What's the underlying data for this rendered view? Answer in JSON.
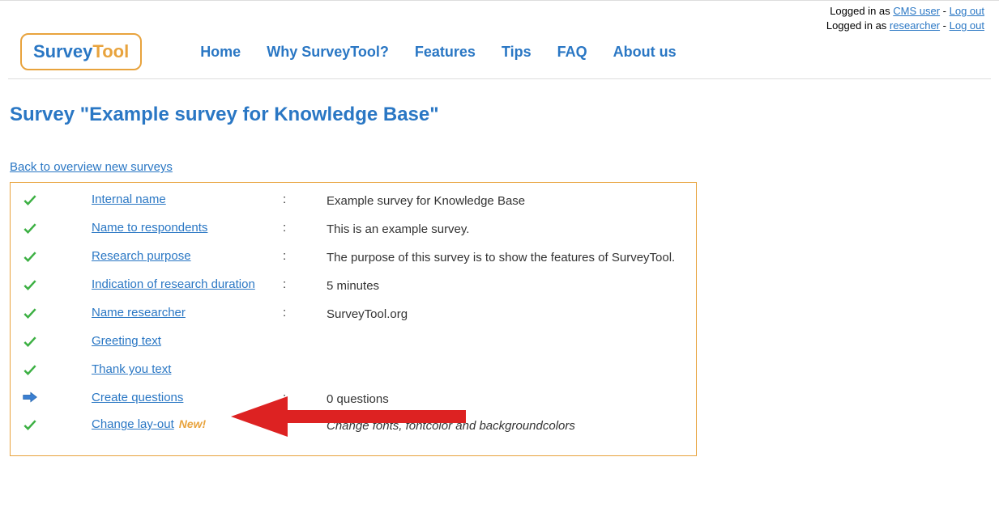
{
  "login": {
    "line1_prefix": "Logged in as ",
    "line1_user": "CMS user",
    "line1_sep": " - ",
    "line1_logout": "Log out",
    "line2_prefix": "Logged in as ",
    "line2_user": "researcher",
    "line2_sep": " - ",
    "line2_logout": "Log out"
  },
  "logo": {
    "part1": "Survey",
    "part2": "Tool"
  },
  "nav": {
    "home": "Home",
    "why": "Why SurveyTool?",
    "features": "Features",
    "tips": "Tips",
    "faq": "FAQ",
    "about": "About us"
  },
  "page_title": "Survey \"Example survey for Knowledge Base\"",
  "back_link": "Back to overview new surveys",
  "rows": {
    "internal_name": {
      "label": "Internal name",
      "value": "Example survey for Knowledge Base"
    },
    "name_respondents": {
      "label": "Name to respondents",
      "value": "This is an example survey."
    },
    "research_purpose": {
      "label": "Research purpose",
      "value": "The purpose of this survey is to show the features of SurveyTool."
    },
    "duration": {
      "label": "Indication of research duration",
      "value": "5 minutes"
    },
    "name_researcher": {
      "label": "Name researcher",
      "value": "SurveyTool.org"
    },
    "greeting": {
      "label": "Greeting text"
    },
    "thankyou": {
      "label": "Thank you text"
    },
    "create_questions": {
      "label": "Create questions",
      "value": "0 questions"
    },
    "layout": {
      "label": "Change lay-out",
      "new": "New!",
      "value": "Change fonts, fontcolor and backgroundcolors"
    }
  },
  "colon": ":"
}
